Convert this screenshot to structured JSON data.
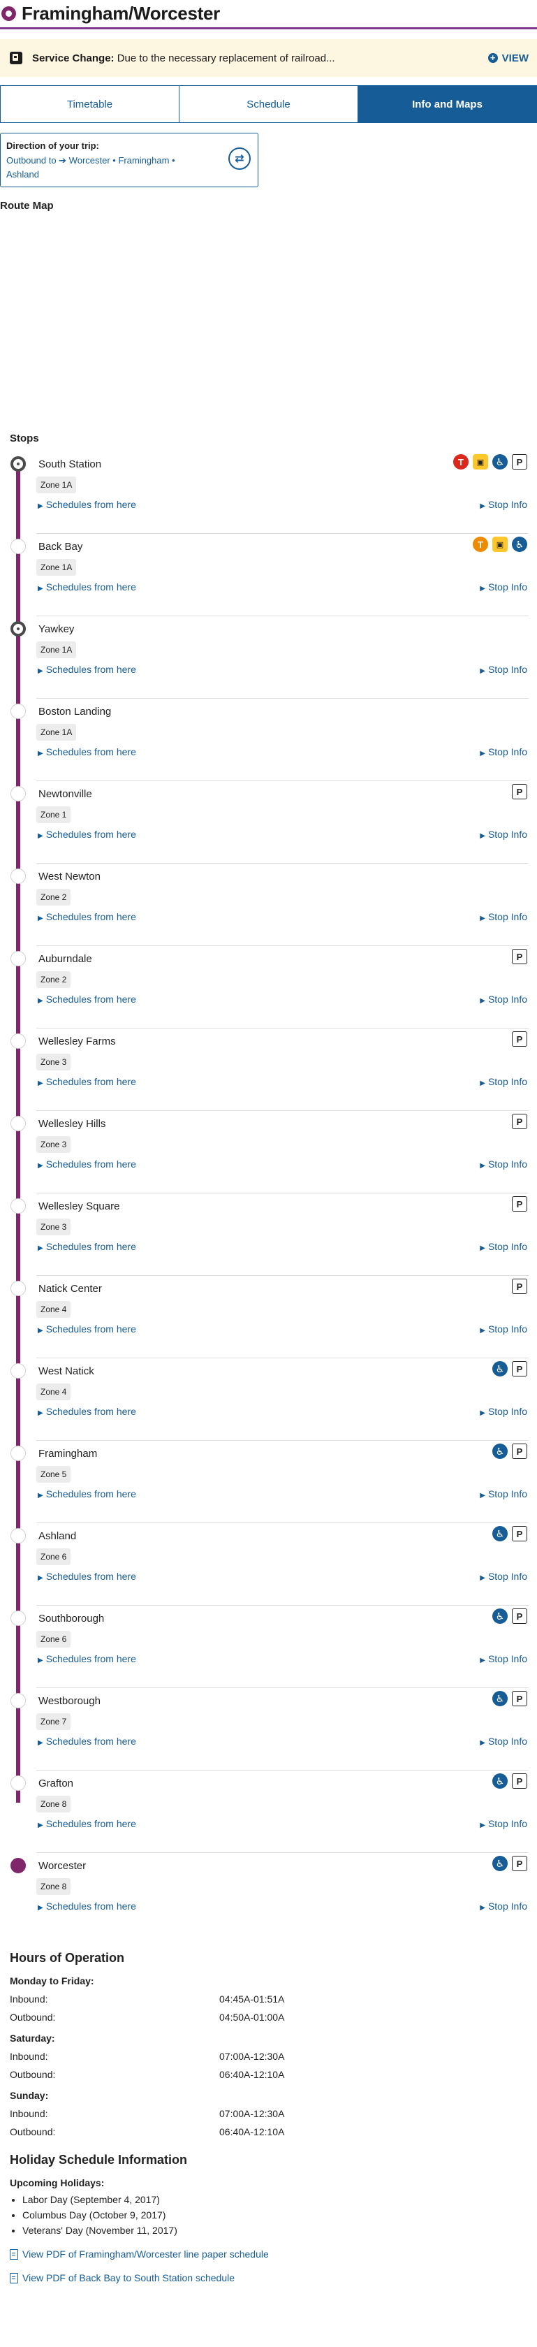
{
  "header": {
    "title": "Framingham/Worcester"
  },
  "alert": {
    "prefix": "Service Change:",
    "message": " Due to the necessary replacement of railroad...",
    "view_label": "VIEW"
  },
  "tabs": [
    {
      "label": "Timetable"
    },
    {
      "label": "Schedule"
    },
    {
      "label": "Info and Maps",
      "active": true
    }
  ],
  "direction": {
    "label": "Direction of your trip:",
    "line1": "Outbound to ➔ Worcester • Framingham •",
    "line2": "Ashland"
  },
  "route_map_title": "Route Map",
  "stops_title": "Stops",
  "link_labels": {
    "schedules": "Schedules from here",
    "stop_info": "Stop Info"
  },
  "stops": [
    {
      "name": "South Station",
      "zone": "Zone 1A",
      "marker": "terminal",
      "icons": [
        "red-line-icon",
        "bus-icon",
        "accessible-icon",
        "parking-icon"
      ]
    },
    {
      "name": "Back Bay",
      "zone": "Zone 1A",
      "marker": "normal",
      "icons": [
        "orange-line-icon",
        "bus-icon",
        "accessible-icon"
      ]
    },
    {
      "name": "Yawkey",
      "zone": "Zone 1A",
      "marker": "terminal",
      "icons": []
    },
    {
      "name": "Boston Landing",
      "zone": "Zone 1A",
      "marker": "normal",
      "icons": []
    },
    {
      "name": "Newtonville",
      "zone": "Zone 1",
      "marker": "normal",
      "icons": [
        "parking-icon"
      ]
    },
    {
      "name": "West Newton",
      "zone": "Zone 2",
      "marker": "normal",
      "icons": []
    },
    {
      "name": "Auburndale",
      "zone": "Zone 2",
      "marker": "normal",
      "icons": [
        "parking-icon"
      ]
    },
    {
      "name": "Wellesley Farms",
      "zone": "Zone 3",
      "marker": "normal",
      "icons": [
        "parking-icon"
      ]
    },
    {
      "name": "Wellesley Hills",
      "zone": "Zone 3",
      "marker": "normal",
      "icons": [
        "parking-icon"
      ]
    },
    {
      "name": "Wellesley Square",
      "zone": "Zone 3",
      "marker": "normal",
      "icons": [
        "parking-icon"
      ]
    },
    {
      "name": "Natick Center",
      "zone": "Zone 4",
      "marker": "normal",
      "icons": [
        "parking-icon"
      ]
    },
    {
      "name": "West Natick",
      "zone": "Zone 4",
      "marker": "normal",
      "icons": [
        "accessible-icon",
        "parking-icon"
      ]
    },
    {
      "name": "Framingham",
      "zone": "Zone 5",
      "marker": "normal",
      "icons": [
        "accessible-icon",
        "parking-icon"
      ]
    },
    {
      "name": "Ashland",
      "zone": "Zone 6",
      "marker": "normal",
      "icons": [
        "accessible-icon",
        "parking-icon"
      ]
    },
    {
      "name": "Southborough",
      "zone": "Zone 6",
      "marker": "normal",
      "icons": [
        "accessible-icon",
        "parking-icon"
      ]
    },
    {
      "name": "Westborough",
      "zone": "Zone 7",
      "marker": "normal",
      "icons": [
        "accessible-icon",
        "parking-icon"
      ]
    },
    {
      "name": "Grafton",
      "zone": "Zone 8",
      "marker": "normal",
      "icons": [
        "accessible-icon",
        "parking-icon"
      ]
    },
    {
      "name": "Worcester",
      "zone": "Zone 8",
      "marker": "end",
      "icons": [
        "accessible-icon",
        "parking-icon"
      ]
    }
  ],
  "hours": {
    "title": "Hours of Operation",
    "groups": [
      {
        "day": "Monday to Friday:",
        "rows": [
          {
            "label": "Inbound:",
            "value": "04:45A-01:51A"
          },
          {
            "label": "Outbound:",
            "value": "04:50A-01:00A"
          }
        ]
      },
      {
        "day": "Saturday:",
        "rows": [
          {
            "label": "Inbound:",
            "value": "07:00A-12:30A"
          },
          {
            "label": "Outbound:",
            "value": "06:40A-12:10A"
          }
        ]
      },
      {
        "day": "Sunday:",
        "rows": [
          {
            "label": "Inbound:",
            "value": "07:00A-12:30A"
          },
          {
            "label": "Outbound:",
            "value": "06:40A-12:10A"
          }
        ]
      }
    ]
  },
  "holiday": {
    "title": "Holiday Schedule Information",
    "subtitle": "Upcoming Holidays:",
    "items": [
      "Labor Day (September 4, 2017)",
      "Columbus Day (October 9, 2017)",
      "Veterans' Day (November 11, 2017)"
    ]
  },
  "pdf_links": [
    "View PDF of Framingham/Worcester line paper schedule",
    "View PDF of Back Bay to South Station schedule"
  ],
  "colors": {
    "brand_purple": "#80276c",
    "link_blue": "#165c96",
    "alert_bg": "#fdf6e0"
  }
}
